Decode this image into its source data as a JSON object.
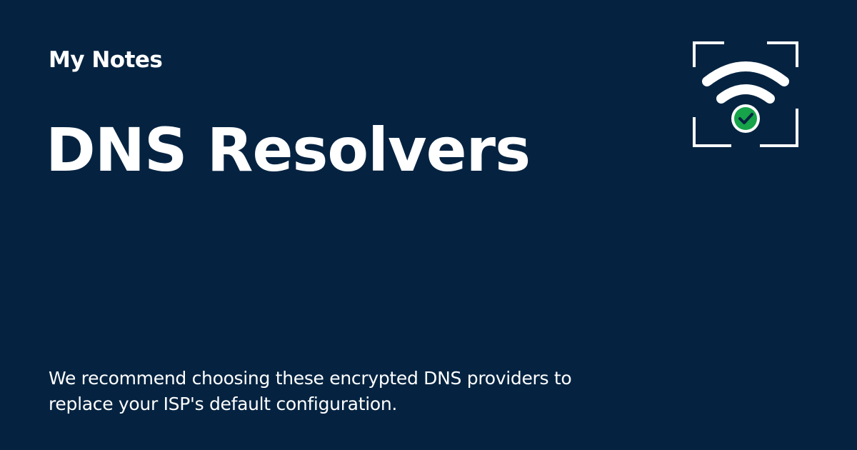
{
  "header": {
    "site_name": "My Notes"
  },
  "main": {
    "title": "DNS Resolvers",
    "description": "We recommend choosing these encrypted DNS providers to replace your ISP's default configuration."
  },
  "logo": {
    "icon": "wifi-check-icon",
    "check_color": "#16a34a"
  },
  "colors": {
    "background": "#052341",
    "text": "#ffffff"
  }
}
